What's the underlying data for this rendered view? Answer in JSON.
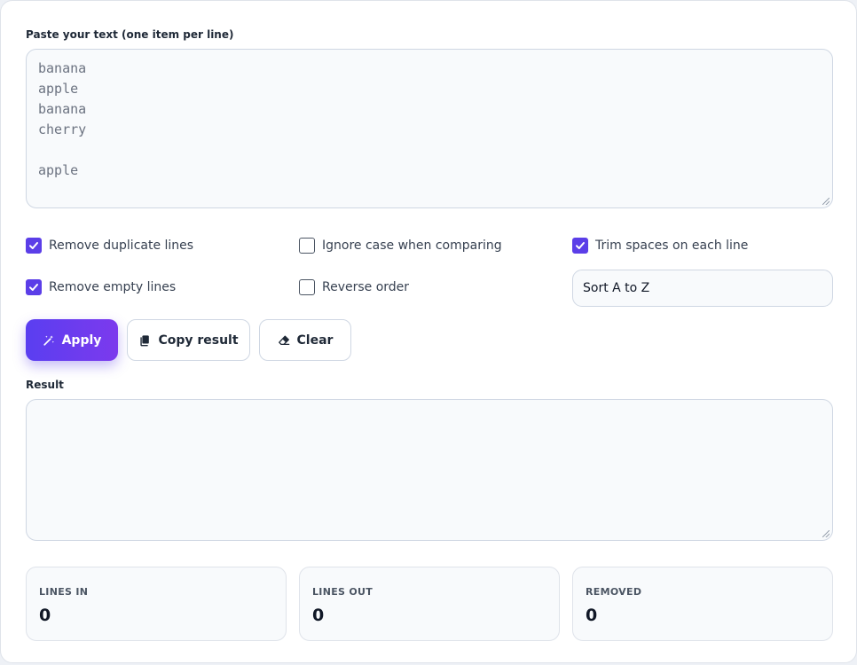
{
  "input": {
    "label": "Paste your text (one item per line)",
    "value": "banana\napple\nbanana\ncherry\n\napple"
  },
  "options": {
    "remove_duplicates": {
      "label": "Remove duplicate lines",
      "checked": true
    },
    "ignore_case": {
      "label": "Ignore case when comparing",
      "checked": false
    },
    "trim_spaces": {
      "label": "Trim spaces on each line",
      "checked": true
    },
    "remove_empty": {
      "label": "Remove empty lines",
      "checked": true
    },
    "reverse_order": {
      "label": "Reverse order",
      "checked": false
    },
    "sort_select": {
      "selected": "Sort A to Z"
    }
  },
  "actions": {
    "apply_label": "Apply",
    "copy_label": "Copy result",
    "clear_label": "Clear"
  },
  "result": {
    "label": "Result",
    "value": ""
  },
  "stats": {
    "lines_in": {
      "label": "LINES IN",
      "value": "0"
    },
    "lines_out": {
      "label": "LINES OUT",
      "value": "0"
    },
    "removed": {
      "label": "REMOVED",
      "value": "0"
    }
  },
  "colors": {
    "accent": "#5b3ee8",
    "accent_gradient_end": "#7c3aed"
  }
}
